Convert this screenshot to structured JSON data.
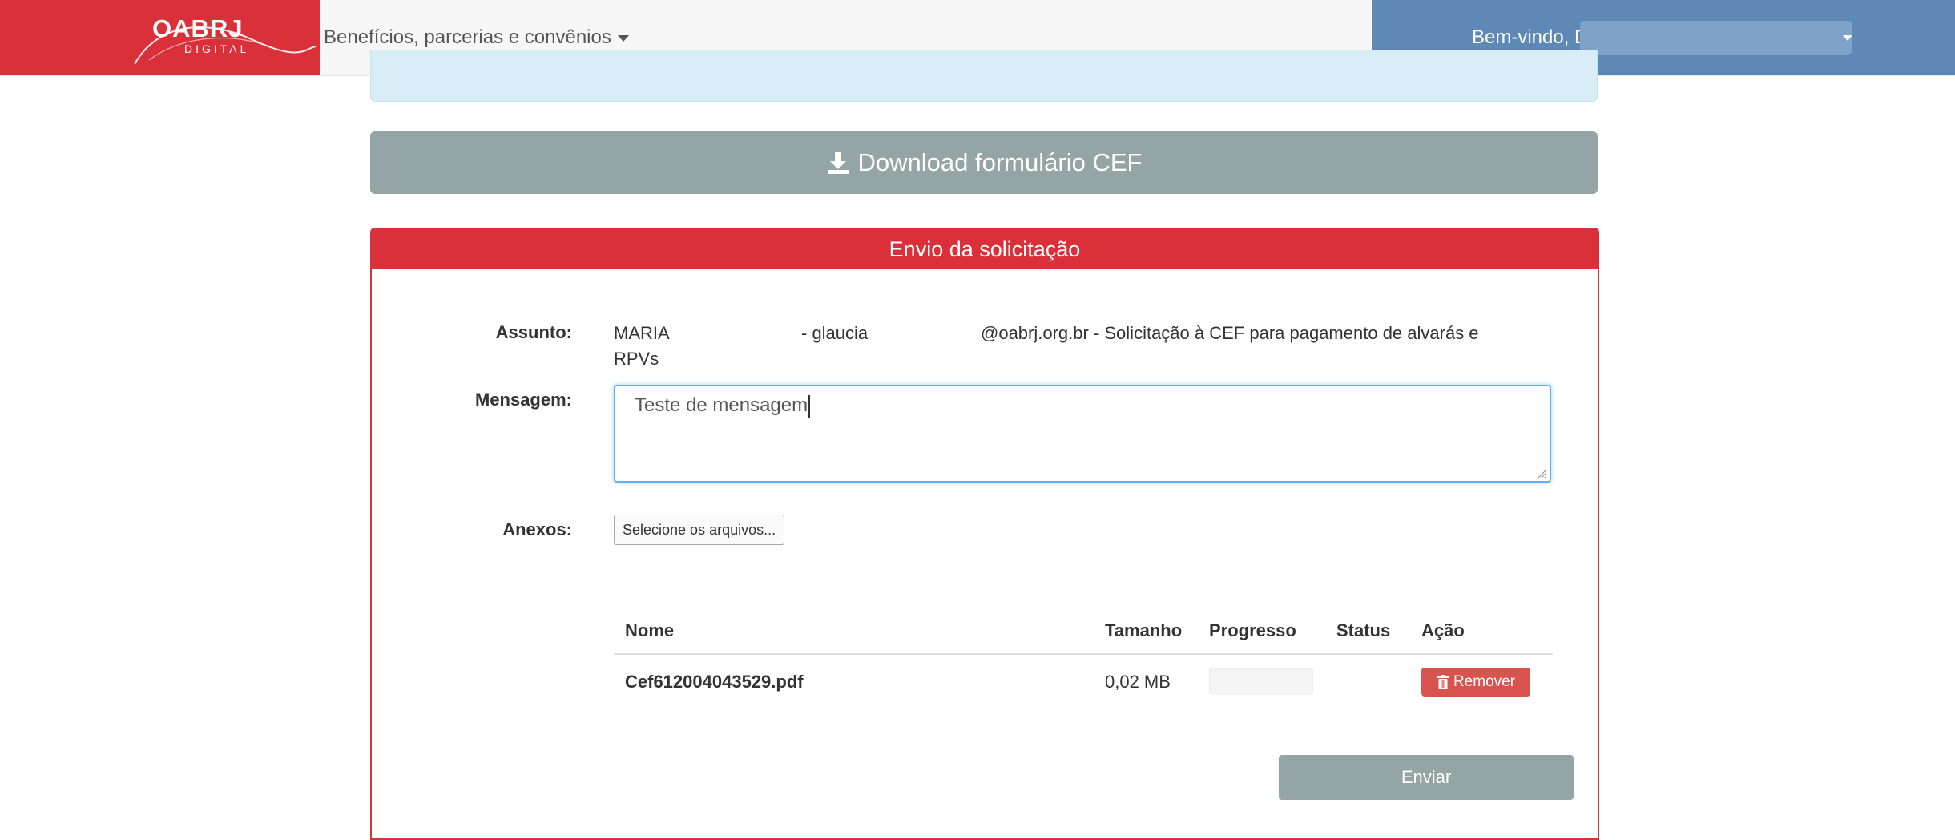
{
  "header": {
    "logo_text": "OABRJ",
    "logo_sub": "DIGITAL",
    "menu_label": "Benefícios, parcerias e convênios",
    "welcome_label": "Bem-vindo, Dra",
    "brand_color": "#d9303a",
    "user_area_color": "#5e88b6"
  },
  "download": {
    "label": "Download formulário CEF",
    "icon": "download-icon"
  },
  "panel": {
    "title": "Envio da solicitação",
    "assunto_label": "Assunto:",
    "assunto_parts": {
      "name": "MARIA",
      "user": "- glaucia",
      "rest": "@oabrj.org.br - Solicitação à CEF para pagamento de alvarás e",
      "line2": "RPVs"
    },
    "mensagem_label": "Mensagem:",
    "mensagem_value": "Teste de mensagem",
    "anexos_label": "Anexos:",
    "file_button_label": "Selecione os arquivos..."
  },
  "files_table": {
    "headers": {
      "name": "Nome",
      "size": "Tamanho",
      "progress": "Progresso",
      "status": "Status",
      "action": "Ação"
    },
    "rows": [
      {
        "name": "Cef612004043529.pdf",
        "size": "0,02 MB",
        "progress": 0,
        "status": "",
        "action_label": "Remover",
        "action_icon": "trash-icon"
      }
    ]
  },
  "submit": {
    "label": "Enviar"
  }
}
